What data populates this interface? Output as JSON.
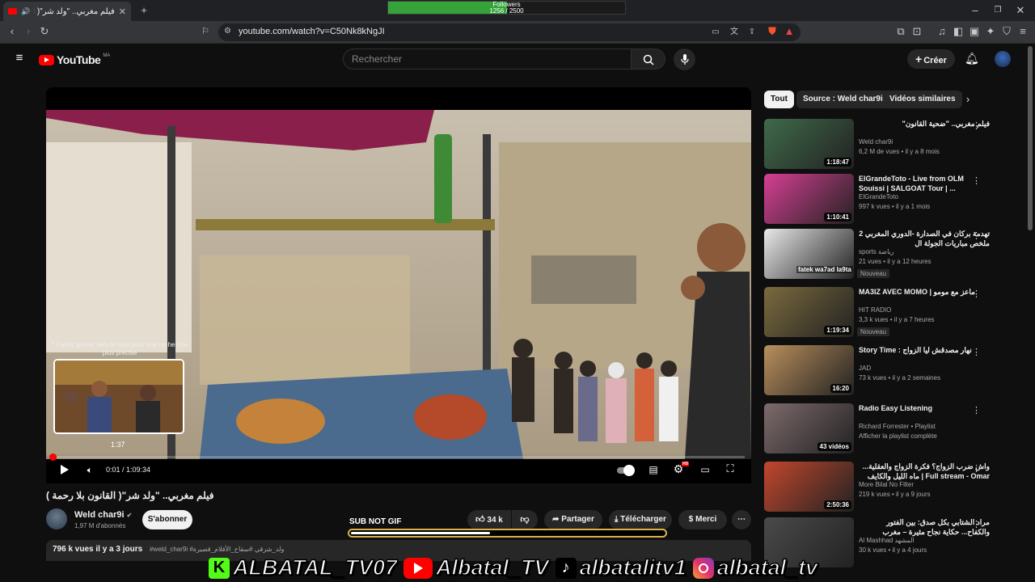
{
  "browser": {
    "tab_title": "فيلم مغربي.. \"ولد شر\"( القانون",
    "followers_title": "Followers",
    "followers_count": "1256 / 2500",
    "followers_progress": 0.5024,
    "url": "youtube.com/watch?v=C50Nk8kNgJI"
  },
  "header": {
    "logo_text": "YouTube",
    "region": "MA",
    "search_placeholder": "Rechercher",
    "create_label": "Créer"
  },
  "player": {
    "hint_text": "Faites glisser vers le haut pour une recherche plus précise",
    "hover_time": "1:37",
    "time_display": "0:01 / 1:09:34",
    "progress": 0.0003,
    "hd_badge": "HD"
  },
  "video": {
    "title": "فيلم مغربي.. \"ولد شر\"( القانون بلا رحمة )",
    "channel": "Weld char9i",
    "subscribers": "1,97 M d'abonnés",
    "subscribe_label": "S'abonner",
    "likes": "34 k",
    "share_label": "Partager",
    "download_label": "Télécharger",
    "thanks_label": "Merci",
    "views_date": "796 k vues  il y a 3 jours",
    "hashtags": "#weld_char9i  #ولد_شرقي  #سفاح_الأفلام_قصيرة"
  },
  "sub_gif": {
    "label": "SUB NOT GIF",
    "progress": 0.44
  },
  "sidebar": {
    "chips": [
      "Tout",
      "Source : Weld char9i",
      "Vidéos similaires"
    ],
    "items": [
      {
        "title": "فيلم مغربي.. \"ضحية القانون\"",
        "channel": "Weld char9i",
        "meta": "6,2 M de vues • il y a 8 mois",
        "duration": "1:18:47",
        "badge": "",
        "thumb": "#3f6a4a"
      },
      {
        "title": "ElGrandeToto - Live from OLM Souissi | SALGOAT Tour | ...",
        "channel": "ElGrandeToto",
        "meta": "997 k vues • il y a 1 mois",
        "duration": "1:10:41",
        "badge": "",
        "thumb": "#d63f93"
      },
      {
        "title": "تهدمة بركان في الصدارة -الدوري المغربي 2 ملخص مباريات الجولة ال",
        "channel": "sports رياضة",
        "meta": "21 vues • il y a 12 heures",
        "duration": "",
        "badge": "Nouveau",
        "thumb": "#e8e8e8",
        "overlay": "fatek wa7ad la9ta"
      },
      {
        "title": "MA3IZ AVEC MOMO | ماعز مع مومو",
        "channel": "HIT RADIO",
        "meta": "3,3 k vues • il y a 7 heures",
        "duration": "1:19:34",
        "badge": "Nouveau",
        "thumb": "#7b6a3e"
      },
      {
        "title": "Story Time : نهار مصدقش ليا الزواج",
        "channel": "JAD",
        "meta": "73 k vues • il y a 2 semaines",
        "duration": "16:20",
        "badge": "",
        "thumb": "#b98f5c"
      },
      {
        "title": "Radio Easy Listening",
        "channel": "Richard Forrester • Playlist",
        "meta": "Afficher la playlist complète",
        "duration": "43 vidéos",
        "badge": "",
        "thumb": "#7d6a6c"
      },
      {
        "title": "واش ضرب الزواج؟ فكرة الزواج والعقلية... Full stream - Omar | ماه الليل والكايف",
        "channel": "More Bilal No Filter",
        "meta": "219 k vues • il y a 9 jours",
        "duration": "2:50:36",
        "badge": "",
        "thumb": "#c2472d"
      },
      {
        "title": "مراد الشتابي بكل صدق: بين الفتور والكفاح... حكاية نجاح مثيرة – مغرب مشارق",
        "channel": "Al Mashhad المشهد",
        "meta": "30 k vues • il y a 4 jours",
        "duration": "",
        "badge": "",
        "thumb": "#4a4a4a"
      }
    ]
  },
  "overlay": {
    "kick": "ALBATAL_TV07",
    "youtube": "Albatal_TV",
    "tiktok": "albatalitv1",
    "instagram": "albatal_tv"
  },
  "colors": {
    "accent": "#ff0000",
    "followers_fill": "#35a33a",
    "gif_border": "#d8b24a"
  }
}
